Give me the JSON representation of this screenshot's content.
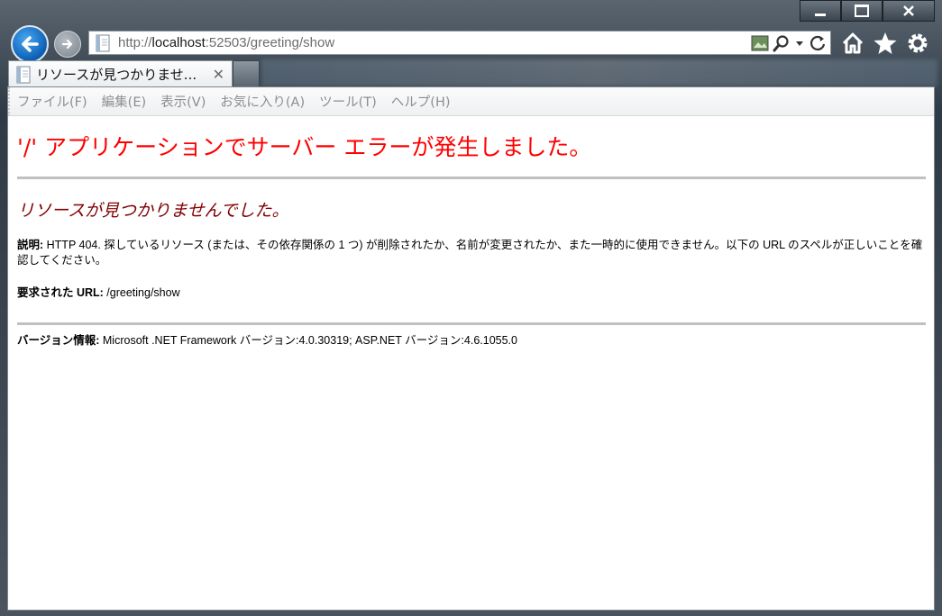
{
  "browser": {
    "address": {
      "scheme": "http://",
      "host": "localhost",
      "rest": ":52503/greeting/show"
    },
    "tab": {
      "title": "リソースが見つかりませ...",
      "close_glyph": "✕"
    },
    "window_buttons": [
      "minimize",
      "maximize",
      "close"
    ],
    "toolbar_icons": [
      "home-icon",
      "favorites-star-icon",
      "tools-gear-icon"
    ]
  },
  "menubar": {
    "items": [
      "ファイル(F)",
      "編集(E)",
      "表示(V)",
      "お気に入り(A)",
      "ツール(T)",
      "ヘルプ(H)"
    ]
  },
  "page": {
    "title": "'/' アプリケーションでサーバー エラーが発生しました。",
    "subtitle": "リソースが見つかりませんでした。",
    "description_label": "説明:",
    "description_text": " HTTP 404. 探しているリソース (または、その依存関係の 1 つ) が削除されたか、名前が変更されたか、また一時的に使用できません。以下の URL のスペルが正しいことを確認してください。",
    "url_label": "要求された URL:",
    "url_value": " /greeting/show",
    "version_label": "バージョン情報:",
    "version_text": " Microsoft .NET Framework バージョン:4.0.30319; ASP.NET バージョン:4.6.1055.0"
  },
  "colors": {
    "title": "#ff0000",
    "subtitle": "#800000",
    "back_button": "#0b5fb5"
  }
}
